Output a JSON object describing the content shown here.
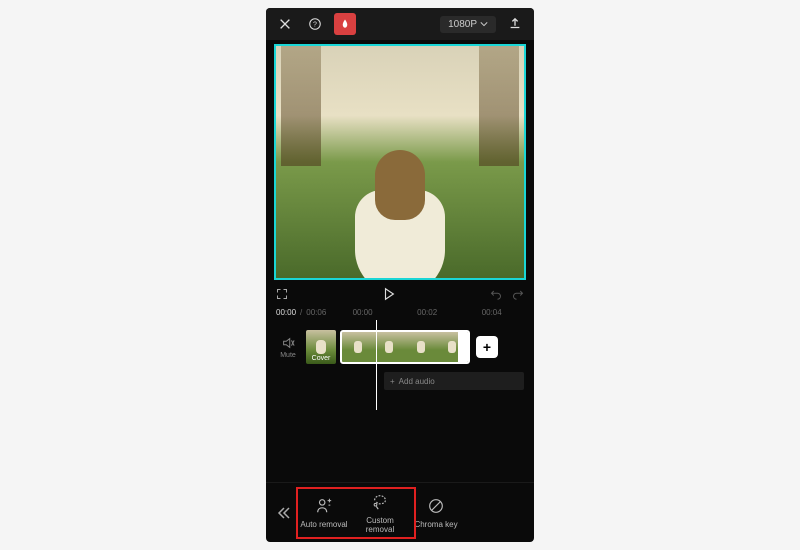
{
  "topbar": {
    "resolution_label": "1080P",
    "close_icon": "close",
    "help_icon": "help",
    "flame_icon": "flame",
    "export_icon": "export"
  },
  "controls": {
    "fullscreen_icon": "fullscreen",
    "play_icon": "play",
    "undo_icon": "undo",
    "redo_icon": "redo"
  },
  "time": {
    "current": "00:00",
    "total": "00:06",
    "marks": [
      "00:00",
      "00:02",
      "00:04"
    ]
  },
  "timeline": {
    "mute_label": "Mute",
    "cover_label": "Cover",
    "add_clip_label": "+",
    "add_audio_label": "Add audio",
    "add_audio_prefix": "+"
  },
  "bottombar": {
    "back_icon": "chevrons-left",
    "tools": [
      {
        "label": "Auto removal",
        "icon": "person-auto"
      },
      {
        "label": "Custom removal",
        "icon": "lasso"
      },
      {
        "label": "Chroma key",
        "icon": "circle-slash"
      }
    ]
  }
}
